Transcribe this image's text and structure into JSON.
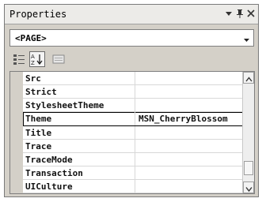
{
  "panel": {
    "title": "Properties",
    "buttons": {
      "dropdown_icon": "dropdown-arrow-icon",
      "pin_icon": "pin-icon",
      "close_icon": "close-icon"
    }
  },
  "selector": {
    "value": "<PAGE>",
    "arrow_icon": "chevron-down-icon"
  },
  "toolbar": {
    "icons": [
      "categorized-icon",
      "alphabetical-sort-icon",
      "property-pages-icon"
    ],
    "active": "alphabetical-sort-icon"
  },
  "properties": {
    "rows": [
      {
        "name": "Src",
        "value": ""
      },
      {
        "name": "Strict",
        "value": ""
      },
      {
        "name": "StylesheetTheme",
        "value": ""
      },
      {
        "name": "Theme",
        "value": "MSN_CherryBlossom"
      },
      {
        "name": "Title",
        "value": ""
      },
      {
        "name": "Trace",
        "value": ""
      },
      {
        "name": "TraceMode",
        "value": ""
      },
      {
        "name": "Transaction",
        "value": ""
      },
      {
        "name": "UICulture",
        "value": ""
      }
    ],
    "selected": "Theme"
  },
  "scrollbar": {
    "position": 0.92
  }
}
